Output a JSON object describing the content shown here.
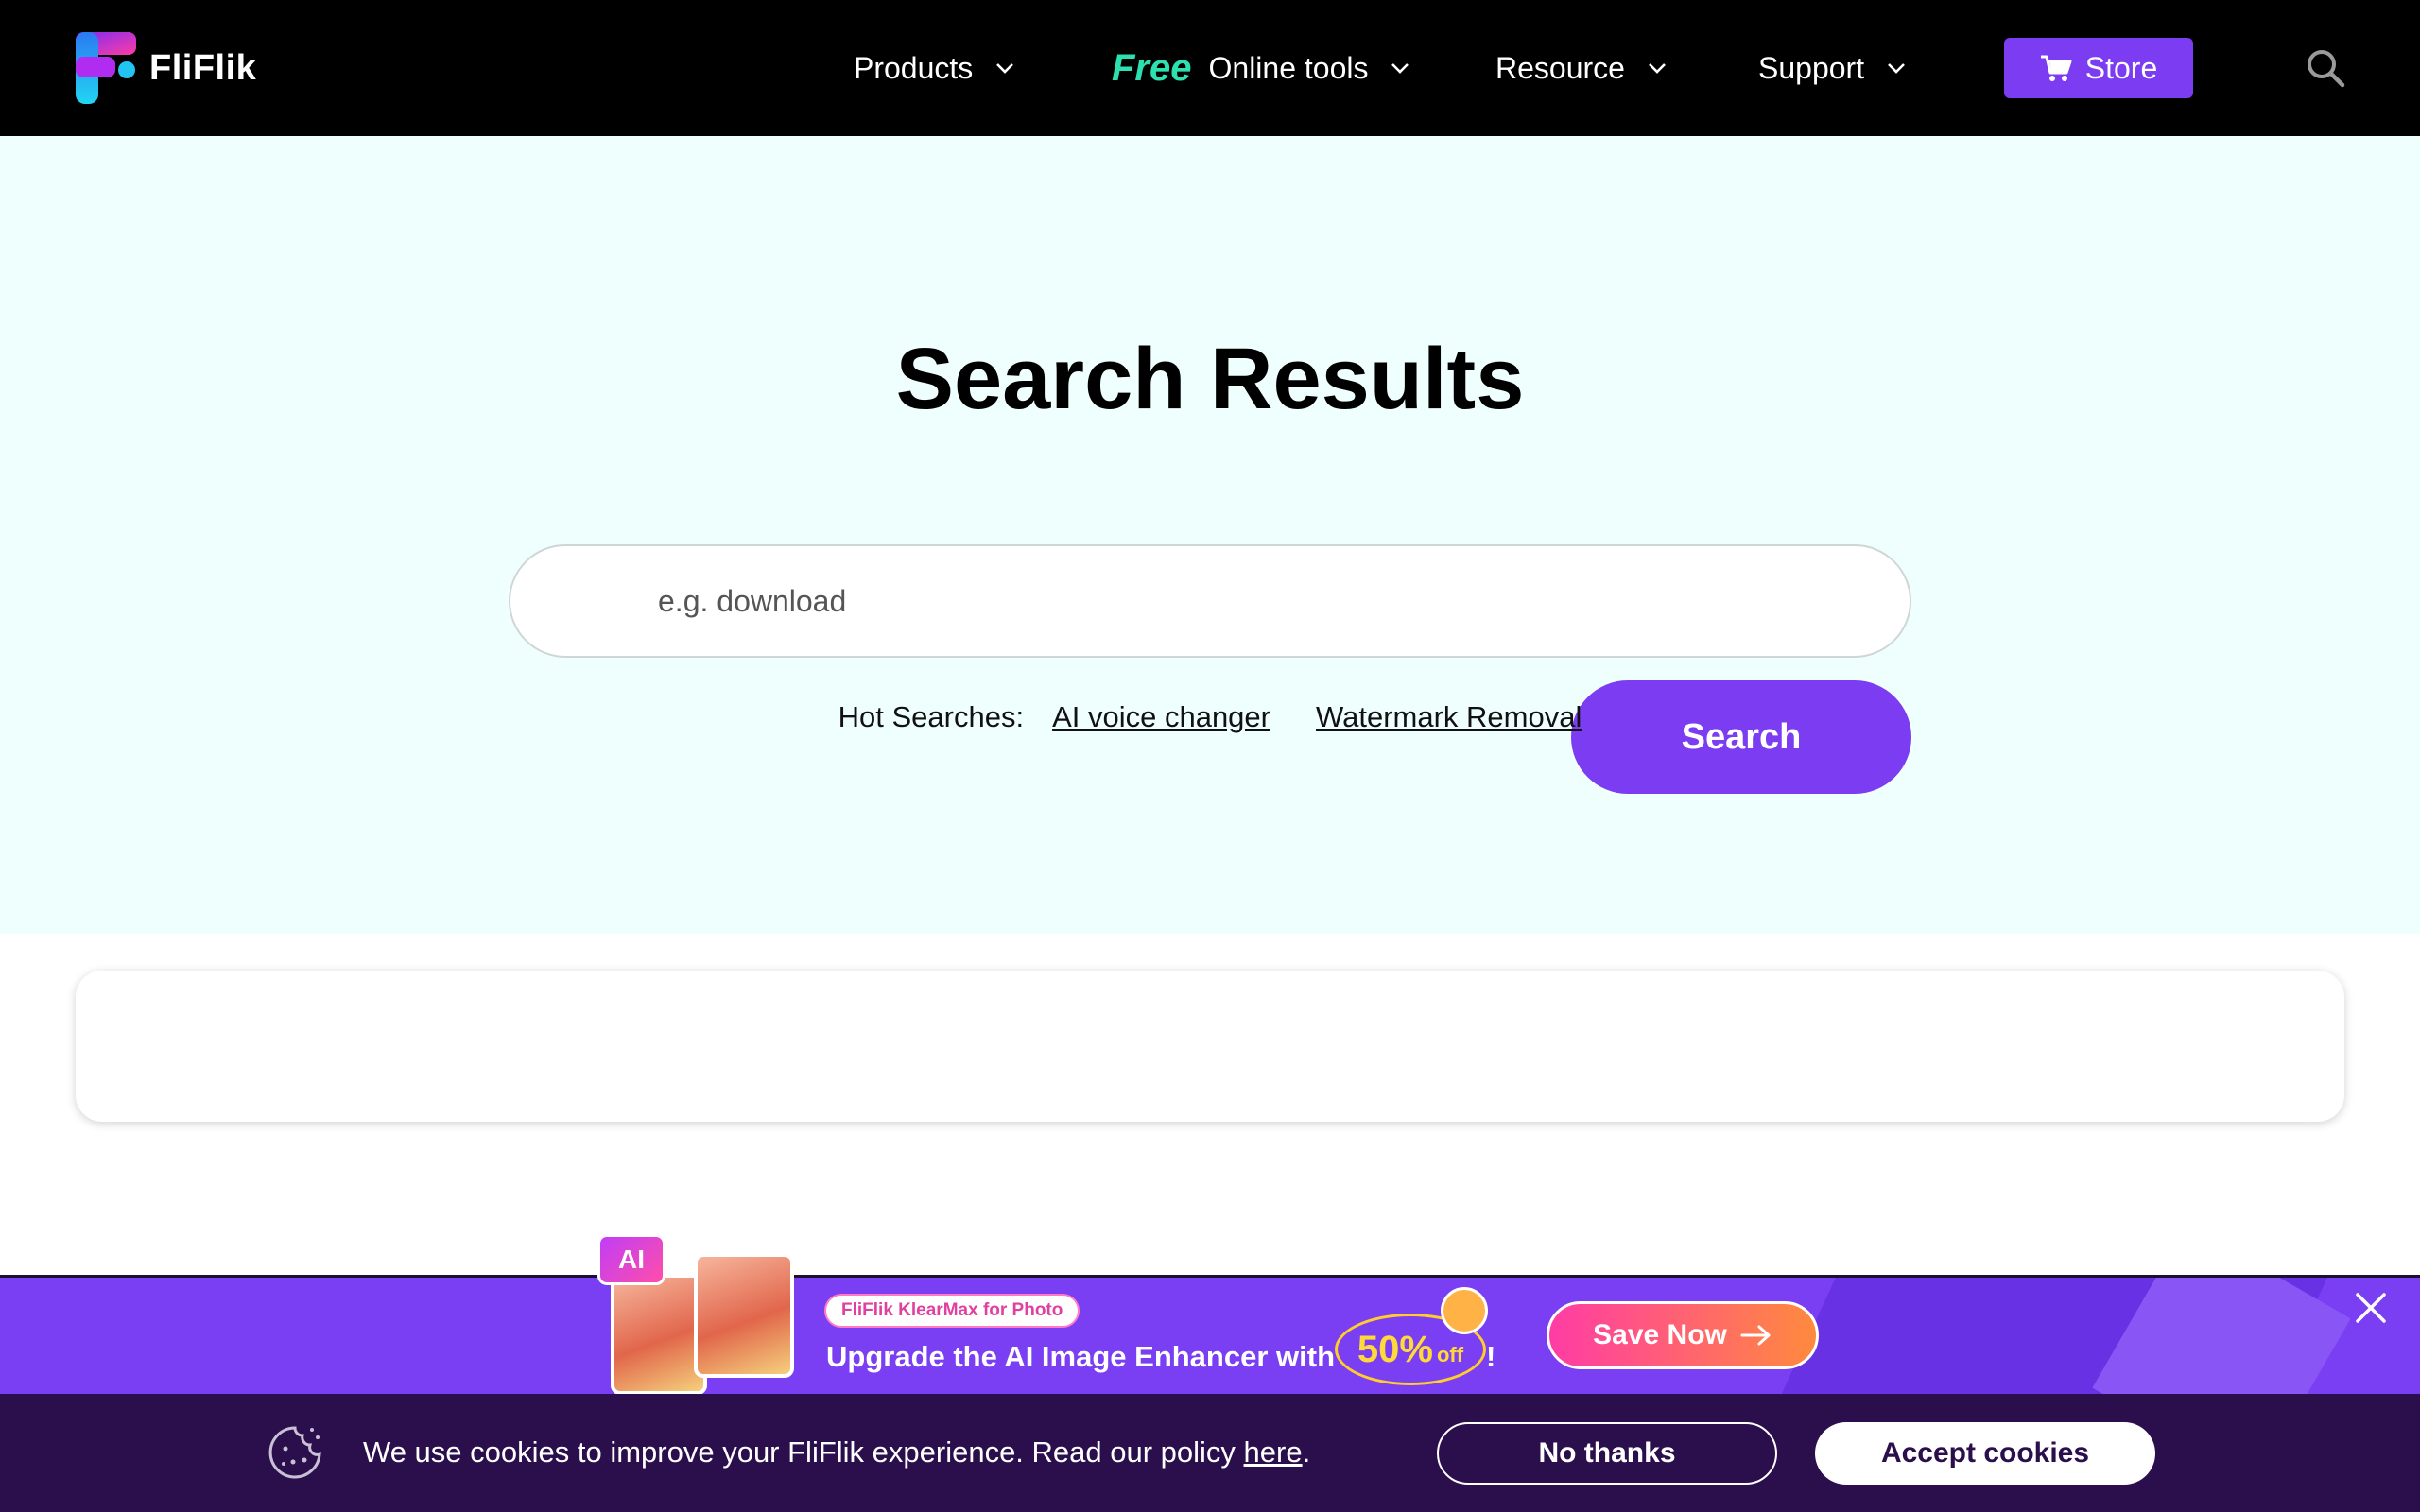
{
  "brand": {
    "name": "FliFlik",
    "logo_colors": [
      "#6a2cf5",
      "#ff3ca5",
      "#22c5f2"
    ]
  },
  "nav": {
    "products": "Products",
    "free_badge": "Free",
    "online_tools": "Online tools",
    "resource": "Resource",
    "support": "Support",
    "store": "Store",
    "search_icon": "search-icon"
  },
  "hero": {
    "title": "Search Results",
    "search_placeholder": "e.g. download",
    "search_value": "",
    "search_button": "Search",
    "hot_label": "Hot Searches:",
    "hot_links": [
      "AI voice changer",
      "Watermark Removal"
    ]
  },
  "promo": {
    "ai_badge": "AI",
    "tag": "FliFlik KlearMax for Photo",
    "headline": "Upgrade the AI Image Enhancer with",
    "discount_value": "50%",
    "discount_suffix": "off",
    "exclamation": "!",
    "cta": "Save Now"
  },
  "cookie": {
    "text_before": "We use cookies to improve your FliFlik experience. Read our policy ",
    "link": "here",
    "text_after": ".",
    "no_thanks": "No thanks",
    "accept": "Accept cookies"
  },
  "colors": {
    "accent": "#7b3cf2",
    "nav_bg": "#000000",
    "hero_bg": "#effffd",
    "free": "#2de0b0",
    "cookie_bg": "#2b0f4d"
  }
}
